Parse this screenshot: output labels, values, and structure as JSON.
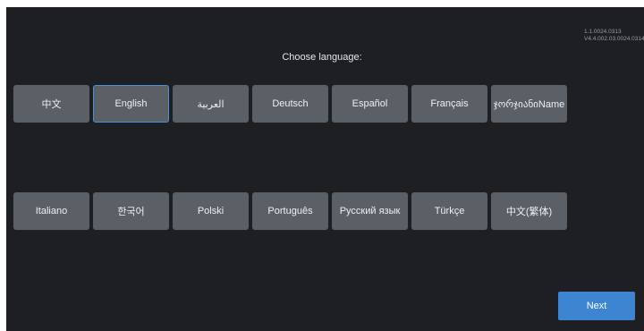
{
  "version": {
    "line1": "1.1.0024.0313",
    "line2": "V4.4.002.03.0024.0314"
  },
  "title": "Choose language:",
  "languages_row1": [
    {
      "label": "中文",
      "selected": false
    },
    {
      "label": "English",
      "selected": true
    },
    {
      "label": "العربية",
      "selected": false
    },
    {
      "label": "Deutsch",
      "selected": false
    },
    {
      "label": "Español",
      "selected": false
    },
    {
      "label": "Français",
      "selected": false
    },
    {
      "label": "ჯორჯიანიName",
      "selected": false
    }
  ],
  "languages_row2": [
    {
      "label": "Italiano",
      "selected": false
    },
    {
      "label": "한국어",
      "selected": false
    },
    {
      "label": "Polski",
      "selected": false
    },
    {
      "label": "Português",
      "selected": false
    },
    {
      "label": "Русский язык",
      "selected": false
    },
    {
      "label": "Türkçe",
      "selected": false
    },
    {
      "label": "中文(繁体)",
      "selected": false
    }
  ],
  "next_label": "Next",
  "colors": {
    "background": "#1d1f22",
    "button": "#5b5f66",
    "selected_border": "#4a90d9",
    "next_button": "#3d85d1"
  }
}
